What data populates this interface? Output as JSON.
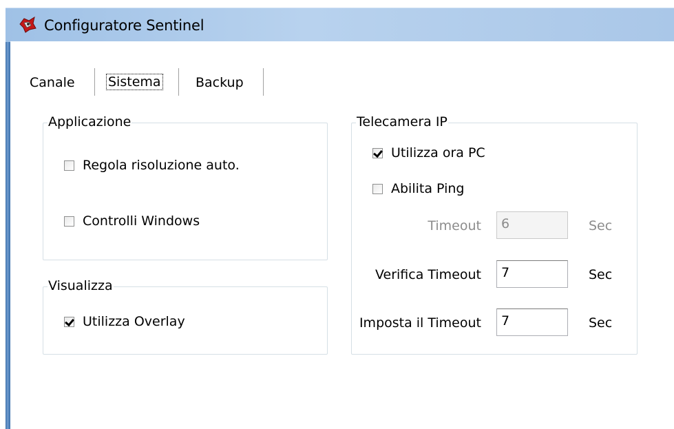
{
  "window": {
    "title": "Configuratore Sentinel",
    "icon": "sentinel-app-icon"
  },
  "tabs": [
    {
      "label": "Canale",
      "active": false
    },
    {
      "label": "Sistema",
      "active": true
    },
    {
      "label": "Backup",
      "active": false
    }
  ],
  "applicazione": {
    "title": "Applicazione",
    "regola_risoluzione": {
      "label": "Regola risoluzione auto.",
      "checked": false
    },
    "controlli_windows": {
      "label": "Controlli Windows",
      "checked": false
    }
  },
  "visualizza": {
    "title": "Visualizza",
    "utilizza_overlay": {
      "label": "Utilizza Overlay",
      "checked": true
    }
  },
  "telecamera": {
    "title": "Telecamera IP",
    "utilizza_ora_pc": {
      "label": "Utilizza ora PC",
      "checked": true
    },
    "abilita_ping": {
      "label": "Abilita Ping",
      "checked": false
    },
    "timeout": {
      "label": "Timeout",
      "value": "6",
      "unit": "Sec",
      "disabled": true
    },
    "verifica_timeout": {
      "label": "Verifica Timeout",
      "value": "7",
      "unit": "Sec"
    },
    "imposta_timeout": {
      "label": "Imposta il Timeout",
      "value": "7",
      "unit": "Sec"
    }
  },
  "colors": {
    "titlebar": "#aac7e8",
    "disabled_text": "#8c8c8c"
  }
}
